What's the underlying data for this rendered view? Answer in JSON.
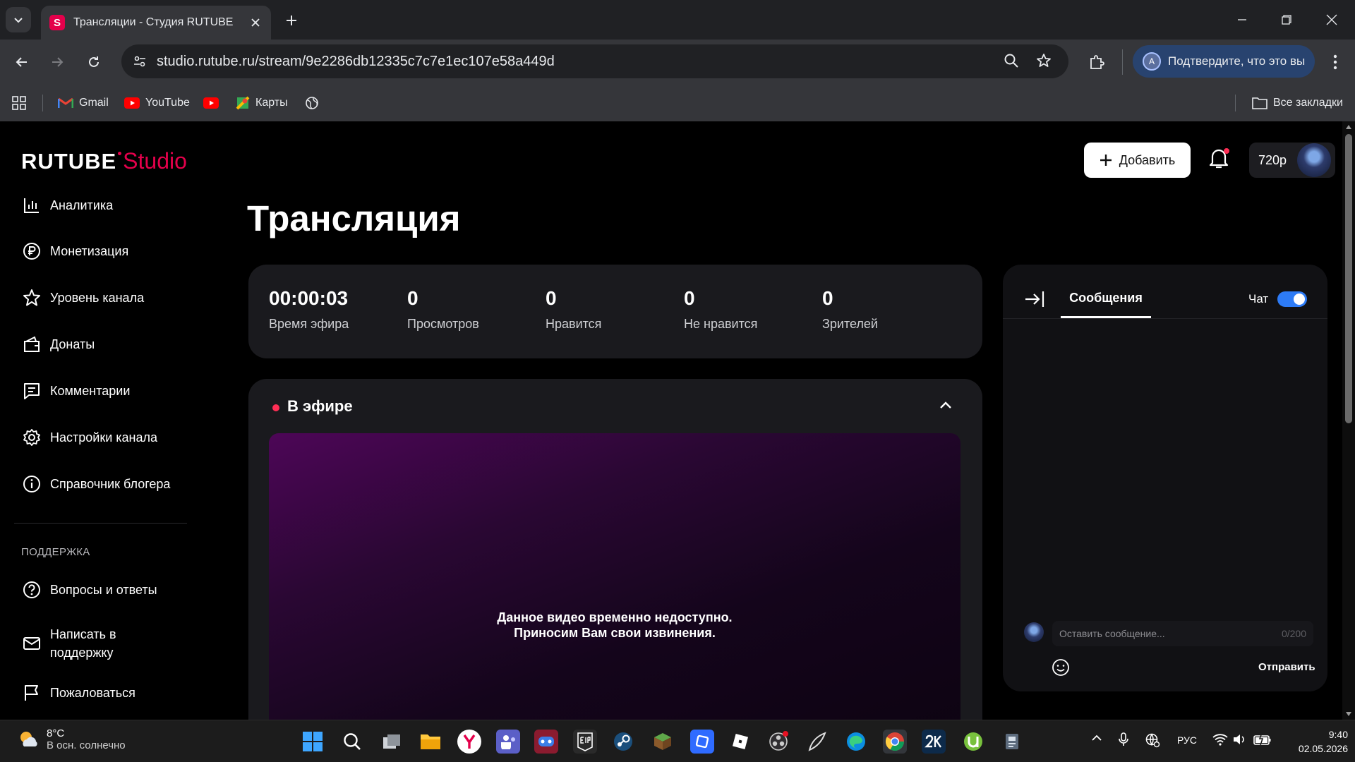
{
  "browser": {
    "tab_title": "Трансляции - Студия RUTUBE",
    "tab_favicon_letter": "S",
    "url": "studio.rutube.ru/stream/9e2286db12335c7c7e1ec107e58a449d",
    "profile_letter": "A",
    "profile_prompt": "Подтвердите, что это вы",
    "bookmarks": [
      {
        "label": "Gmail",
        "icon": "gmail-icon"
      },
      {
        "label": "YouTube",
        "icon": "youtube-icon"
      },
      {
        "label": "",
        "icon": "youtube-icon"
      },
      {
        "label": "Карты",
        "icon": "maps-icon"
      },
      {
        "label": "",
        "icon": "globe-icon"
      }
    ],
    "all_bookmarks": "Все закладки"
  },
  "logo": {
    "brand": "RUTUBE",
    "product": "Studio"
  },
  "sidebar": {
    "items": [
      {
        "label": "Аналитика",
        "icon": "analytics-icon"
      },
      {
        "label": "Монетизация",
        "icon": "ruble-icon"
      },
      {
        "label": "Уровень канала",
        "icon": "star-icon"
      },
      {
        "label": "Донаты",
        "icon": "wallet-icon"
      },
      {
        "label": "Комментарии",
        "icon": "comment-icon"
      },
      {
        "label": "Настройки канала",
        "icon": "gear-icon"
      },
      {
        "label": "Справочник блогера",
        "icon": "info-icon"
      }
    ],
    "support_title": "ПОДДЕРЖКА",
    "support_items": [
      {
        "label": "Вопросы и ответы",
        "icon": "question-icon"
      },
      {
        "label": "Написать в поддержку",
        "icon": "mail-icon"
      },
      {
        "label": "Пожаловаться",
        "icon": "flag-icon"
      }
    ]
  },
  "header": {
    "add_label": "Добавить",
    "balance": "720р"
  },
  "main": {
    "title": "Трансляция",
    "stats": [
      {
        "value": "00:00:03",
        "label": "Время эфира"
      },
      {
        "value": "0",
        "label": "Просмотров"
      },
      {
        "value": "0",
        "label": "Нравится"
      },
      {
        "value": "0",
        "label": "Не нравится"
      },
      {
        "value": "0",
        "label": "Зрителей"
      }
    ],
    "live_title": "В эфире",
    "player_message_line1": "Данное видео временно недоступно.",
    "player_message_line2": "Приносим Вам свои извинения."
  },
  "chat": {
    "tab_label": "Сообщения",
    "toggle_label": "Чат",
    "toggle_on": true,
    "input_placeholder": "Оставить сообщение...",
    "counter": "0/200",
    "send_label": "Отправить"
  },
  "taskbar": {
    "temperature": "8°C",
    "weather": "В осн. солнечно",
    "language": "РУС",
    "time": "9:40",
    "date": "02.05.2026"
  },
  "colors": {
    "accent": "#e4004b",
    "toggle": "#2d7bf6",
    "live_dot": "#ff2e55"
  }
}
